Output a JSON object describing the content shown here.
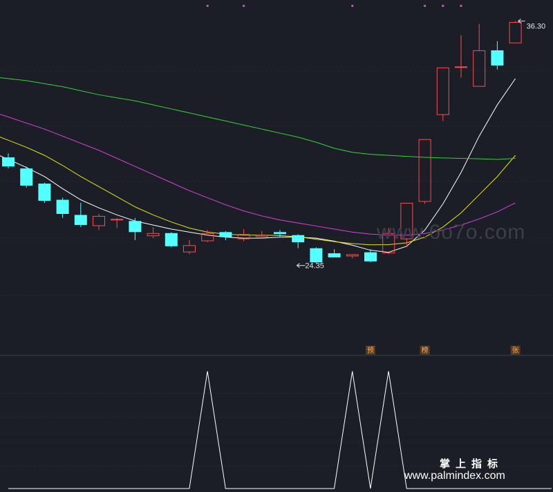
{
  "chart_data": [
    {
      "type": "candlestick",
      "price_range": [
        20.6,
        37.0
      ],
      "high_label": "36.30",
      "low_label": "24.35",
      "candles": [
        {
          "o": 29.55,
          "c": 29.1,
          "h": 29.75,
          "l": 29.0
        },
        {
          "o": 29.0,
          "c": 28.15,
          "h": 29.1,
          "l": 28.05
        },
        {
          "o": 28.25,
          "c": 27.4,
          "h": 28.3,
          "l": 27.3
        },
        {
          "o": 27.45,
          "c": 26.75,
          "h": 27.55,
          "l": 26.55
        },
        {
          "o": 26.7,
          "c": 26.2,
          "h": 27.3,
          "l": 26.1
        },
        {
          "o": 26.15,
          "c": 26.65,
          "h": 26.75,
          "l": 25.95
        },
        {
          "o": 26.5,
          "c": 26.5,
          "h": 26.55,
          "l": 26.05
        },
        {
          "o": 26.4,
          "c": 25.85,
          "h": 26.55,
          "l": 25.45
        },
        {
          "o": 25.65,
          "c": 25.8,
          "h": 26.1,
          "l": 25.55
        },
        {
          "o": 25.8,
          "c": 25.15,
          "h": 25.85,
          "l": 25.1
        },
        {
          "o": 24.85,
          "c": 25.2,
          "h": 25.45,
          "l": 24.75
        },
        {
          "o": 25.4,
          "c": 25.8,
          "h": 25.95,
          "l": 25.35
        },
        {
          "o": 25.85,
          "c": 25.6,
          "h": 25.9,
          "l": 25.45
        },
        {
          "o": 25.5,
          "c": 25.75,
          "h": 26.0,
          "l": 25.4
        },
        {
          "o": 25.6,
          "c": 25.7,
          "h": 25.9,
          "l": 25.55
        },
        {
          "o": 25.85,
          "c": 25.75,
          "h": 25.95,
          "l": 25.6
        },
        {
          "o": 25.7,
          "c": 25.35,
          "h": 25.75,
          "l": 25.05
        },
        {
          "o": 25.05,
          "c": 24.35,
          "h": 25.1,
          "l": 24.3
        },
        {
          "o": 24.8,
          "c": 24.6,
          "h": 25.0,
          "l": 24.6
        },
        {
          "o": 24.65,
          "c": 24.75,
          "h": 24.75,
          "l": 24.55
        },
        {
          "o": 24.85,
          "c": 24.4,
          "h": 25.0,
          "l": 24.35
        },
        {
          "o": 24.8,
          "c": 25.8,
          "h": 26.05,
          "l": 24.75
        },
        {
          "o": 25.5,
          "c": 27.3,
          "h": 27.3,
          "l": 25.1
        },
        {
          "o": 27.35,
          "c": 30.45,
          "h": 30.45,
          "l": 27.25
        },
        {
          "o": 31.65,
          "c": 34.0,
          "h": 34.0,
          "l": 31.35
        },
        {
          "o": 34.0,
          "c": 34.05,
          "h": 35.6,
          "l": 33.5
        },
        {
          "o": 33.05,
          "c": 34.85,
          "h": 36.15,
          "l": 33.05
        },
        {
          "o": 34.85,
          "c": 34.1,
          "h": 35.3,
          "l": 33.9
        },
        {
          "o": 35.2,
          "c": 36.25,
          "h": 36.3,
          "l": 35.2
        }
      ],
      "ma": [
        {
          "color": "#ffffff",
          "values": [
            29.45,
            29.05,
            28.6,
            28.0,
            27.45,
            27.05,
            26.7,
            26.4,
            26.2,
            26.0,
            25.85,
            25.7,
            25.6,
            25.55,
            25.55,
            25.6,
            25.6,
            25.55,
            25.4,
            25.2,
            24.95,
            24.85,
            25.15,
            25.95,
            27.25,
            28.8,
            30.6,
            32.15,
            33.45
          ]
        },
        {
          "color": "#e8e800",
          "values": [
            30.4,
            30.05,
            29.65,
            29.15,
            28.6,
            28.1,
            27.6,
            27.1,
            26.7,
            26.35,
            26.05,
            25.85,
            25.75,
            25.7,
            25.7,
            25.68,
            25.62,
            25.5,
            25.38,
            25.28,
            25.22,
            25.23,
            25.32,
            25.6,
            26.1,
            26.8,
            27.7,
            28.6,
            29.65
          ]
        },
        {
          "color": "#e040e0",
          "values": [
            31.55,
            31.25,
            30.95,
            30.6,
            30.25,
            29.9,
            29.5,
            29.1,
            28.7,
            28.3,
            27.9,
            27.55,
            27.2,
            26.9,
            26.65,
            26.45,
            26.3,
            26.15,
            26.0,
            25.85,
            25.75,
            25.7,
            25.7,
            25.78,
            25.95,
            26.2,
            26.5,
            26.85,
            27.3
          ]
        },
        {
          "color": "#32d632",
          "values": [
            33.45,
            33.35,
            33.2,
            33.05,
            32.85,
            32.65,
            32.5,
            32.35,
            32.15,
            31.95,
            31.75,
            31.55,
            31.35,
            31.15,
            30.95,
            30.75,
            30.55,
            30.3,
            30.0,
            29.8,
            29.7,
            29.65,
            29.6,
            29.55,
            29.52,
            29.5,
            29.48,
            29.45,
            29.5
          ]
        }
      ],
      "markers": [
        {
          "index": 20,
          "label": "预"
        },
        {
          "index": 23,
          "label": "榜"
        },
        {
          "index": 28,
          "label": "张"
        }
      ],
      "top_dots": [
        11,
        13,
        19,
        23,
        24,
        25
      ]
    },
    {
      "type": "line",
      "range": [
        0,
        1
      ],
      "values": [
        0,
        0,
        0,
        0,
        0,
        0,
        0,
        0,
        0,
        0,
        0,
        1,
        0,
        0,
        0,
        0,
        0,
        0,
        0,
        1,
        0,
        1,
        0,
        0,
        0,
        0,
        0,
        0,
        0,
        0,
        0
      ],
      "color": "#ffffff"
    }
  ],
  "watermark": "www.6o7o.com",
  "footer": {
    "title": "掌上指标",
    "site": "www.palmindex.com"
  }
}
